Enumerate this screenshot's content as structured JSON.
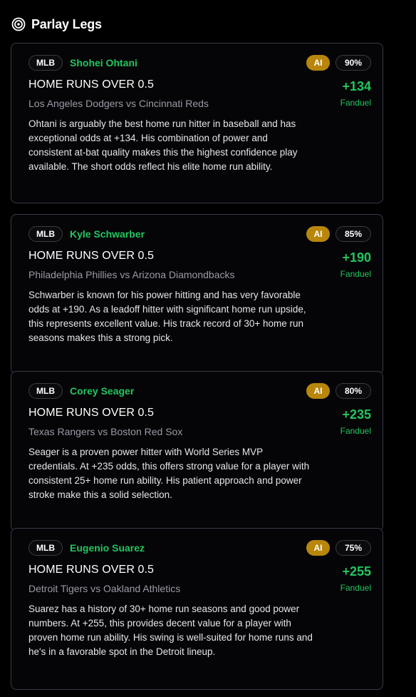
{
  "header": {
    "title": "Parlay Legs",
    "icon": "target-icon"
  },
  "colors": {
    "accent_green": "#22c55e",
    "ai_badge": "#b8860b",
    "card_border": "#3a3a48",
    "background": "#000000"
  },
  "legs": [
    {
      "league": "MLB",
      "player": "Shohei Ohtani",
      "ai_label": "AI",
      "confidence": "90%",
      "market": "HOME RUNS OVER 0.5",
      "matchup": "Los Angeles Dodgers vs Cincinnati Reds",
      "odds": "+134",
      "book": "Fanduel",
      "description": "Ohtani is arguably the best home run hitter in baseball and has exceptional odds at +134. His combination of power and consistent at-bat quality makes this the highest confidence play available. The short odds reflect his elite home run ability."
    },
    {
      "league": "MLB",
      "player": "Kyle Schwarber",
      "ai_label": "AI",
      "confidence": "85%",
      "market": "HOME RUNS OVER 0.5",
      "matchup": "Philadelphia Phillies vs Arizona Diamondbacks",
      "odds": "+190",
      "book": "Fanduel",
      "description": "Schwarber is known for his power hitting and has very favorable odds at +190. As a leadoff hitter with significant home run upside, this represents excellent value. His track record of 30+ home run seasons makes this a strong pick."
    },
    {
      "league": "MLB",
      "player": "Corey Seager",
      "ai_label": "AI",
      "confidence": "80%",
      "market": "HOME RUNS OVER 0.5",
      "matchup": "Texas Rangers vs Boston Red Sox",
      "odds": "+235",
      "book": "Fanduel",
      "description": "Seager is a proven power hitter with World Series MVP credentials. At +235 odds, this offers strong value for a player with consistent 25+ home run ability. His patient approach and power stroke make this a solid selection."
    },
    {
      "league": "MLB",
      "player": "Eugenio Suarez",
      "ai_label": "AI",
      "confidence": "75%",
      "market": "HOME RUNS OVER 0.5",
      "matchup": "Detroit Tigers vs Oakland Athletics",
      "odds": "+255",
      "book": "Fanduel",
      "description": "Suarez has a history of 30+ home run seasons and good power numbers. At +255, this provides decent value for a player with proven home run ability. His swing is well-suited for home runs and he's in a favorable spot in the Detroit lineup."
    }
  ]
}
